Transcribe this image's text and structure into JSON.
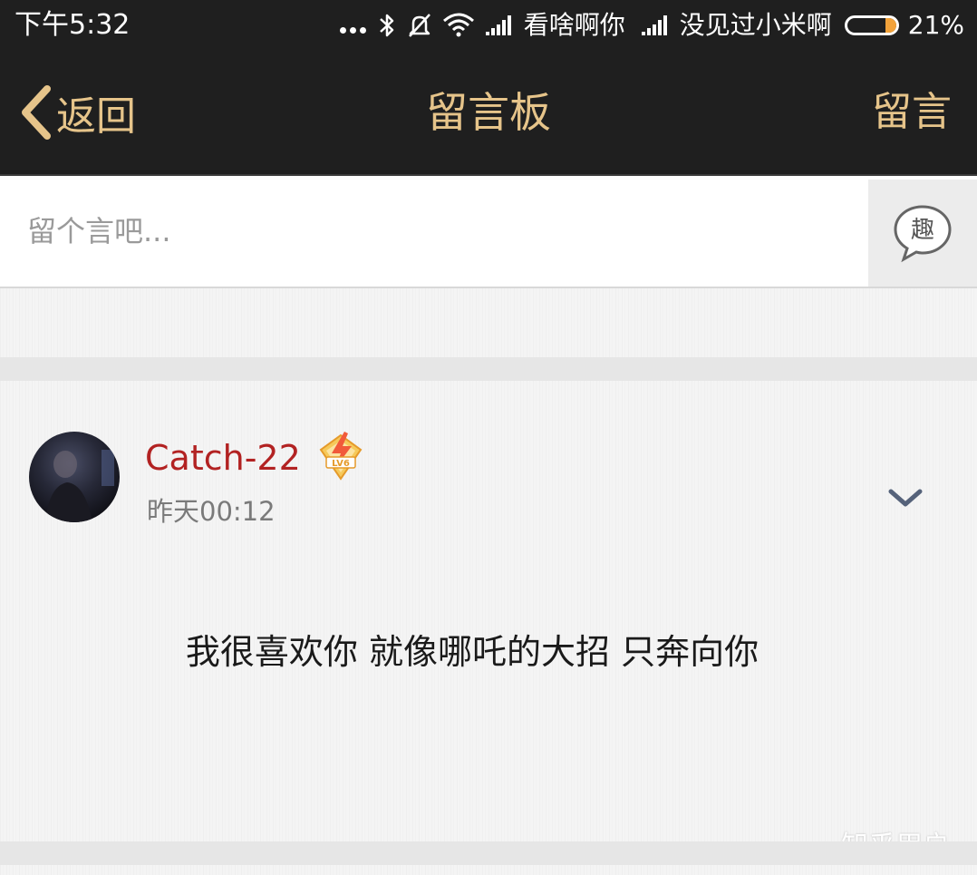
{
  "status_bar": {
    "time": "下午5:32",
    "carrier_1": "看啥啊你",
    "carrier_2": "没见过小米啊",
    "battery_percent": "21%",
    "battery_level": 0.21,
    "icons": [
      "more-dots-icon",
      "bluetooth-icon",
      "mute-bell-icon",
      "wifi-icon",
      "signal-icon",
      "signal-icon",
      "battery-icon"
    ]
  },
  "header": {
    "back_label": "返回",
    "title": "留言板",
    "post_label": "留言"
  },
  "composer": {
    "placeholder": "留个言吧...",
    "fun_button_label": "趣"
  },
  "message": {
    "username": "Catch-22",
    "badge_text": "LV6",
    "timestamp": "昨天00:12",
    "text": "我很喜欢你 就像哪吒的大招 只奔向你"
  },
  "watermark": "知乎用户",
  "colors": {
    "header_bg": "#1f1f1f",
    "accent_gold": "#e6c48a",
    "username_red": "#b22222",
    "battery_orange": "#f2a23a"
  }
}
